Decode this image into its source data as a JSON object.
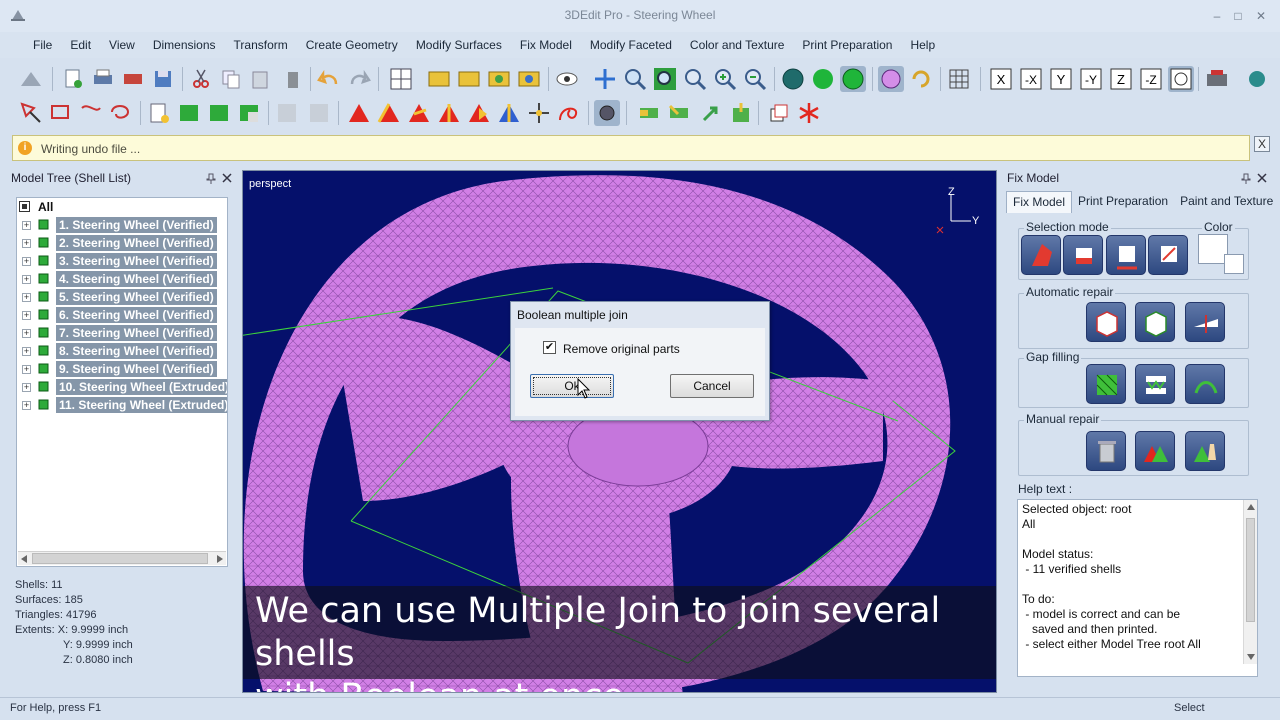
{
  "window": {
    "title": "3DEdit Pro - Steering Wheel",
    "min": "–",
    "max": "□",
    "close": "✕"
  },
  "menu": [
    "File",
    "Edit",
    "View",
    "Dimensions",
    "Transform",
    "Create Geometry",
    "Modify Surfaces",
    "Fix Model",
    "Modify Faceted",
    "Color and Texture",
    "Print Preparation",
    "Help"
  ],
  "infobar": {
    "icon": "i",
    "text": "Writing undo file ...",
    "close": "X"
  },
  "model_tree": {
    "title": "Model Tree (Shell List)",
    "root": "All",
    "items": [
      "1. Steering Wheel (Verified)",
      "2. Steering Wheel (Verified)",
      "3. Steering Wheel (Verified)",
      "4. Steering Wheel (Verified)",
      "5. Steering Wheel (Verified)",
      "6. Steering Wheel (Verified)",
      "7. Steering Wheel (Verified)",
      "8. Steering Wheel (Verified)",
      "9. Steering Wheel (Verified)",
      "10. Steering Wheel (Extruded)",
      "11. Steering Wheel (Extruded)"
    ]
  },
  "stats": {
    "shells": "Shells: 11",
    "surfaces": "Surfaces: 185",
    "triangles": "Triangles: 41796",
    "extents_x": "Extents:   X: 9.9999 inch",
    "extents_y": "Y: 9.9999 inch",
    "extents_z": "Z: 0.8080 inch"
  },
  "viewport": {
    "label": "perspect",
    "axis_z": "Z",
    "axis_y": "Y",
    "caption_line1": "We can use Multiple Join to join several shells",
    "caption_line2": "with Boolean at once.",
    "mesh_color": "#d27fe6",
    "background_color": "#05106b"
  },
  "dialog": {
    "title": "Boolean multiple join",
    "checkbox_label": "Remove original parts",
    "checkbox_checked": true,
    "check_glyph": "✔",
    "ok_label": "Ok",
    "cancel_label": "Cancel"
  },
  "fix_panel": {
    "title": "Fix Model",
    "tabs": [
      "Fix Model",
      "Print Preparation",
      "Paint and Texture"
    ],
    "selection_mode": "Selection mode",
    "color": "Color",
    "automatic_repair": "Automatic repair",
    "gap_filling": "Gap filling",
    "manual_repair": "Manual repair",
    "help_title": "Help text :",
    "help_lines": [
      "Selected object: root",
      "All",
      "",
      "Model status:",
      " - 11 verified shells",
      "",
      "To do:",
      " - model is correct and can be",
      "   saved and then printed.",
      " - select either Model Tree root All"
    ]
  },
  "statusbar": {
    "left": "For Help, press F1",
    "right": "Select"
  }
}
